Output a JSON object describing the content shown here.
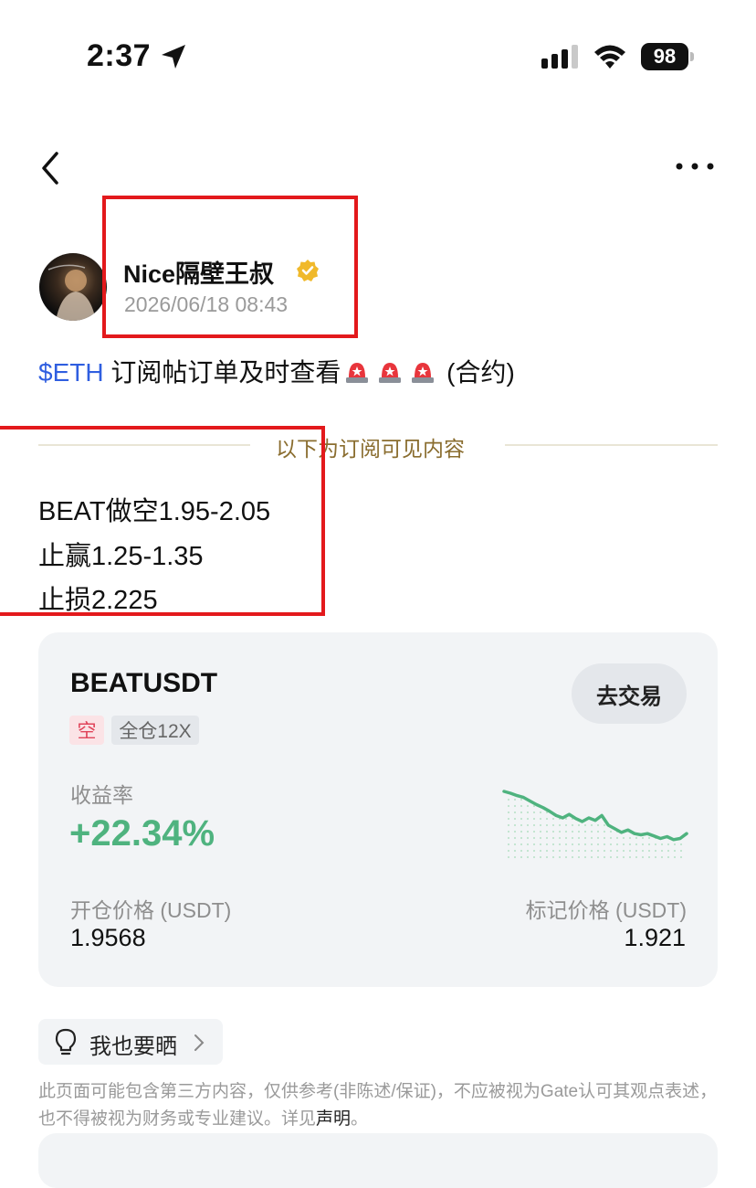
{
  "status_bar": {
    "time": "2:37",
    "battery": "98"
  },
  "author": {
    "name": "Nice隔壁王叔",
    "time": "2026/06/18 08:43"
  },
  "post": {
    "ticker": "$ETH",
    "title": " 订阅帖订单及时查看",
    "suffix": " (合约)",
    "divider": "以下为订阅可见内容",
    "lines": [
      "BEAT做空1.95-2.05",
      "止赢1.25-1.35",
      "止损2.225"
    ]
  },
  "card": {
    "pair": "BEATUSDT",
    "trade_button": "去交易",
    "side": "空",
    "margin": "全仓12X",
    "yield_label": "收益率",
    "yield_value": "+22.34%",
    "open_label": "开仓价格 (USDT)",
    "open_value": "1.9568",
    "mark_label": "标记价格 (USDT)",
    "mark_value": "1.921",
    "trend": [
      1.0,
      0.97,
      0.93,
      0.9,
      0.84,
      0.78,
      0.73,
      0.67,
      0.6,
      0.56,
      0.62,
      0.55,
      0.5,
      0.56,
      0.52,
      0.6,
      0.44,
      0.38,
      0.32,
      0.36,
      0.3,
      0.28,
      0.3,
      0.26,
      0.22,
      0.25,
      0.2,
      0.22,
      0.3
    ]
  },
  "share": {
    "label": "我也要晒"
  },
  "disclaimer": {
    "text": "此页面可能包含第三方内容，仅供参考(非陈述/保证)，不应被视为Gate认可其观点表述，也不得被视为财务或专业建议。详见",
    "link": "声明",
    "end": "。"
  },
  "colors": {
    "positive": "#4fb37f",
    "accent_blue": "#2f5ee0",
    "annotation_red": "#e3191c",
    "short_red": "#e0445a"
  }
}
